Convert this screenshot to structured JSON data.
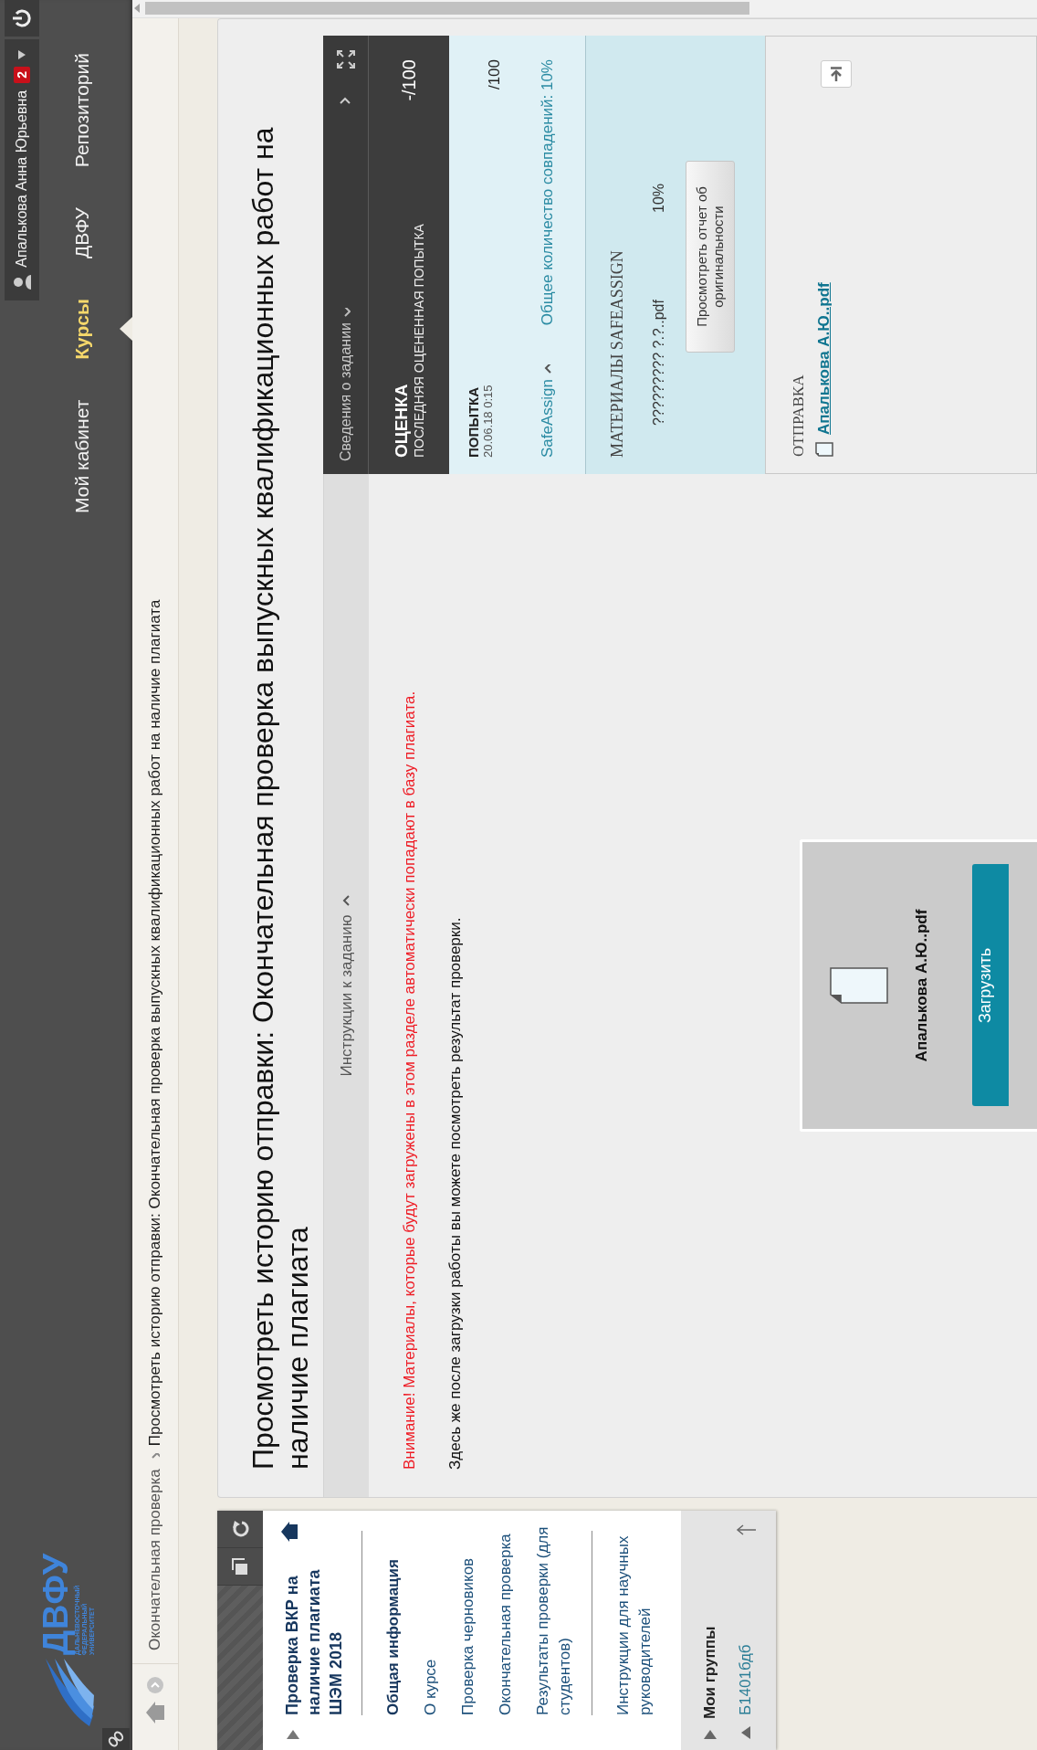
{
  "header": {
    "logo": {
      "name": "ДВФУ",
      "subtitle": [
        "ДАЛЬНЕВОСТОЧНЫЙ",
        "ФЕДЕРАЛЬНЫЙ",
        "УНИВЕРСИТЕТ"
      ]
    },
    "nav": [
      {
        "label": "Мой кабинет",
        "selected": false
      },
      {
        "label": "Курсы",
        "selected": true
      },
      {
        "label": "ДВФУ",
        "selected": false
      },
      {
        "label": "Репозиторий",
        "selected": false
      }
    ],
    "user": {
      "name": "Апалькова Анна Юрьевна",
      "badge": "2"
    }
  },
  "breadcrumb": [
    "Окончательная проверка",
    "Просмотреть историю отправки: Окончательная проверка выпускных квалификационных работ на наличие плагиата"
  ],
  "course_menu": {
    "title": "Проверка ВКР на наличие плагиата ШЭМ 2018",
    "sections": [
      {
        "items": [
          {
            "kind": "heading",
            "label": "Общая информация"
          },
          {
            "kind": "link",
            "label": "О курсе"
          },
          {
            "kind": "link",
            "label": "Проверка черновиков"
          },
          {
            "kind": "link",
            "label": "Окончательная проверка"
          },
          {
            "kind": "link",
            "label": "Результаты проверки (для студентов)"
          }
        ]
      },
      {
        "items": [
          {
            "kind": "link",
            "label": "Инструкции для научных руководителей"
          }
        ]
      }
    ],
    "groups": {
      "title": "Мои группы",
      "items": [
        "Б1401бдб"
      ]
    }
  },
  "page": {
    "title": "Просмотреть историю отправки: Окончательная проверка выпускных квалификационных работ на наличие плагиата",
    "instructions": {
      "label": "Инструкции к заданию",
      "expanded": true,
      "warning": "Внимание! Материалы, которые будут загружены в этом разделе автоматически попадают в базу плагиата.",
      "note": "Здесь же после загрузки работы вы можете посмотреть результат проверки."
    },
    "upload": {
      "file": "Апалькова А.Ю..pdf",
      "button": "Загрузить"
    }
  },
  "details": {
    "title": "Сведения о задании",
    "grade": {
      "label": "ОЦЕНКА",
      "sublabel": "ПОСЛЕДНЯЯ ОЦЕНЕННАЯ ПОПЫТКА",
      "value": "-/100"
    },
    "attempt": {
      "label": "ПОПЫТКА",
      "date": "20.06.18 0:15",
      "value": "/100",
      "safeassign": {
        "label": "SafeAssign",
        "expanded": true,
        "total": "Общее количество совпадений: 10%"
      }
    },
    "materials": {
      "title": "МАТЕРИАЛЫ SAFEASSIGN",
      "file": "????????? ?.?..pdf",
      "percent": "10%",
      "button": "Просмотреть отчет об оригинальности"
    },
    "submission": {
      "title": "ОТПРАВКА",
      "file": "Апалькова А.Ю..pdf"
    }
  }
}
